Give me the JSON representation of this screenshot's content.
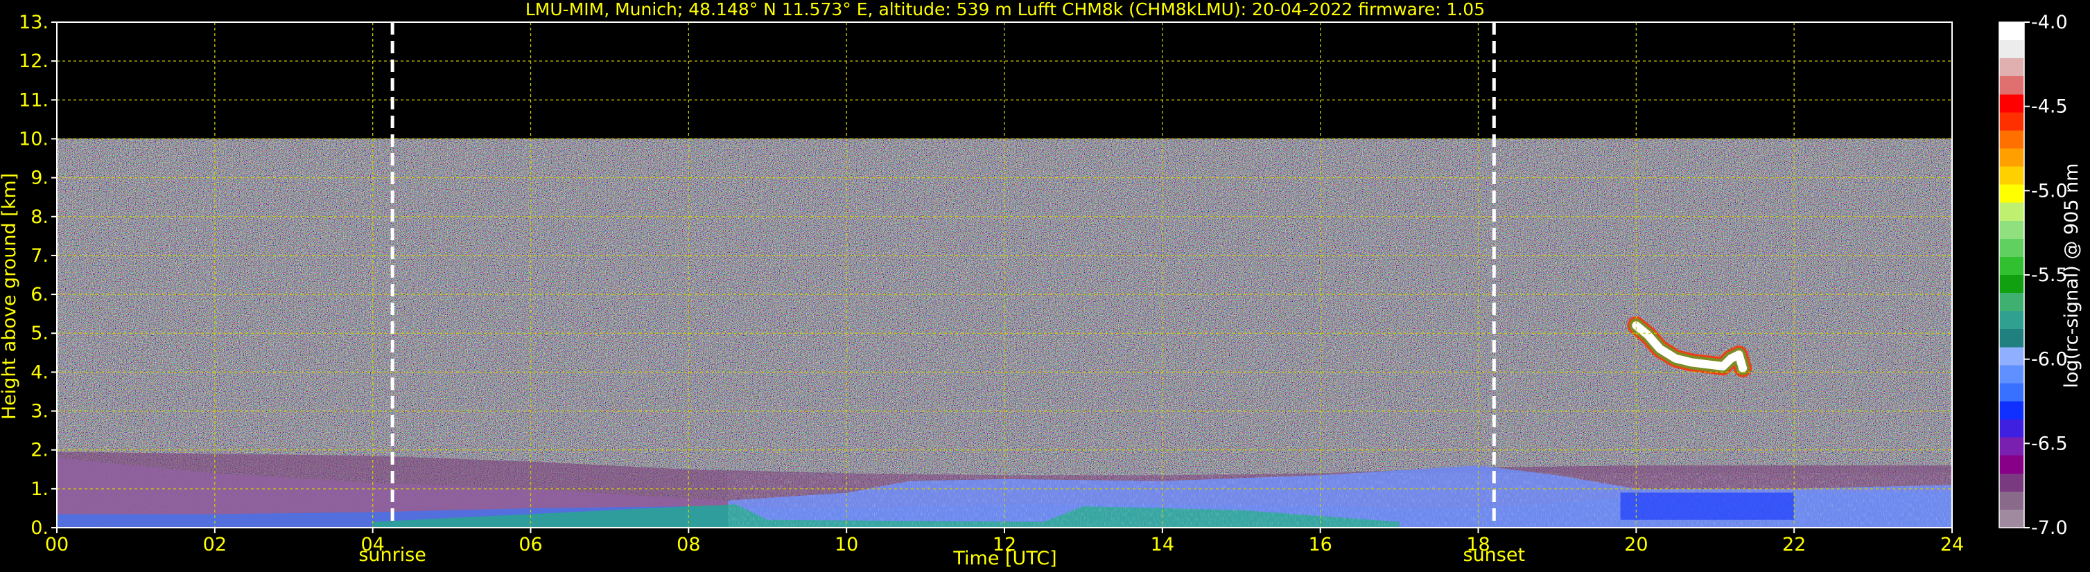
{
  "chart_data": {
    "type": "heatmap",
    "title": "LMU-MIM, Munich; 48.148° N 11.573° E, altitude: 539 m    Lufft CHM8k (CHM8kLMU): 20-04-2022    firmware: 1.05",
    "xlabel": "Time [UTC]",
    "ylabel": "Height above ground [km]",
    "xlim": [
      0,
      24
    ],
    "ylim": [
      0,
      13
    ],
    "x_ticks": [
      "00",
      "02",
      "04",
      "06",
      "08",
      "10",
      "12",
      "14",
      "16",
      "18",
      "20",
      "22",
      "24"
    ],
    "y_ticks": [
      "0.",
      "1.",
      "2.",
      "3.",
      "4.",
      "5.",
      "6.",
      "7.",
      "8.",
      "9.",
      "10.",
      "11.",
      "12.",
      "13."
    ],
    "grid": true,
    "data_top_km": 10.0,
    "markers": [
      {
        "label": "sunrise",
        "time": 4.25
      },
      {
        "label": "sunset",
        "time": 18.2
      }
    ],
    "colorbar": {
      "label": "log(rc-signal) @ 905 nm",
      "range": [
        -7.0,
        -4.0
      ],
      "ticks": [
        "-4.0",
        "-4.5",
        "-5.0",
        "-5.5",
        "-6.0",
        "-6.5",
        "-7.0"
      ],
      "colors": [
        "#a08aa0",
        "#8a6a8a",
        "#7a3a80",
        "#880088",
        "#7a20b0",
        "#4020e0",
        "#1030ff",
        "#3870ff",
        "#6090ff",
        "#90b0ff",
        "#208080",
        "#30a090",
        "#40b070",
        "#10a010",
        "#30c030",
        "#60d060",
        "#90e080",
        "#c0f070",
        "#ffff00",
        "#ffd000",
        "#ffa000",
        "#ff7000",
        "#ff3000",
        "#ff0000",
        "#e07070",
        "#e0b0b0",
        "#ececec",
        "#ffffff"
      ]
    },
    "layers": [
      {
        "name": "",
        "x": [
          0,
          2,
          4,
          6,
          8,
          10,
          12,
          14,
          16,
          18,
          20,
          22,
          24
        ],
        "top": [
          1.95,
          1.9,
          1.85,
          1.7,
          1.5,
          1.4,
          1.35,
          1.35,
          1.4,
          1.55,
          1.6,
          1.6,
          1.6
        ]
      },
      {
        "name": "",
        "x": [
          0,
          2,
          4,
          6,
          8,
          8.5,
          10,
          10.8,
          12,
          14,
          16,
          18,
          19,
          20,
          22,
          24
        ],
        "top": [
          1.8,
          1.4,
          1.15,
          1.0,
          0.75,
          0.7,
          0.9,
          1.2,
          1.25,
          1.2,
          1.35,
          1.6,
          1.35,
          1.0,
          1.0,
          1.1
        ]
      },
      {
        "name": "",
        "x": [
          0,
          2,
          4,
          6,
          8,
          8.5,
          10,
          10.8,
          12,
          14,
          16,
          18,
          20,
          22,
          24
        ],
        "top": [
          0.35,
          0.35,
          0.4,
          0.5,
          0.55,
          0.55,
          0.5,
          0.55,
          0.6,
          0.6,
          0.55,
          0.5,
          0.8,
          0.9,
          0.9
        ]
      }
    ],
    "cloud": {
      "x": [
        20.0,
        20.15,
        20.3,
        20.5,
        20.7,
        20.9,
        21.1,
        21.2,
        21.3,
        21.35
      ],
      "y": [
        5.2,
        4.95,
        4.6,
        4.35,
        4.25,
        4.2,
        4.15,
        4.35,
        4.45,
        4.1
      ]
    }
  }
}
